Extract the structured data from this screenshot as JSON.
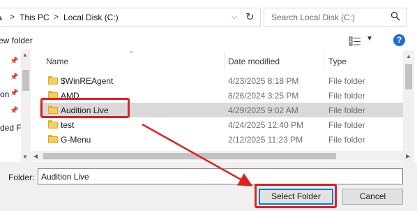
{
  "address_bar": {
    "breadcrumb": [
      "This PC",
      "Local Disk (C:)"
    ],
    "separator": ">"
  },
  "search": {
    "placeholder": "Search Local Disk (C:)"
  },
  "toolbar": {
    "new_folder_label": "ew folder"
  },
  "nav_pane": {
    "items": [
      {
        "label": "",
        "pinned": true
      },
      {
        "label": "",
        "pinned": true
      },
      {
        "label": "on",
        "pinned": true
      },
      {
        "label": "",
        "pinned": true
      },
      {
        "label": "ded Fi",
        "pinned": false
      }
    ]
  },
  "columns": {
    "name": "Name",
    "date": "Date modified",
    "type": "Type"
  },
  "files": [
    {
      "name": "$WinREAgent",
      "date": "4/23/2025 8:18 PM",
      "type": "File folder"
    },
    {
      "name": "AMD",
      "date": "8/26/2024 3:25 PM",
      "type": "File folder"
    },
    {
      "name": "Audition Live",
      "date": "4/29/2025 9:02 AM",
      "type": "File folder",
      "selected": true
    },
    {
      "name": "test",
      "date": "4/24/2025 12:40 PM",
      "type": "File folder"
    },
    {
      "name": "G-Menu",
      "date": "2/12/2025 11:23 PM",
      "type": "File folder"
    }
  ],
  "footer": {
    "folder_label": "Folder:",
    "folder_value": "Audition Live",
    "select_label": "Select Folder",
    "cancel_label": "Cancel"
  },
  "help_label": "?",
  "colors": {
    "highlight": "#e02020",
    "selected_row": "#d9d9d9",
    "help_blue": "#1e6fd1",
    "folder_yellow": "#f5cf5b"
  }
}
